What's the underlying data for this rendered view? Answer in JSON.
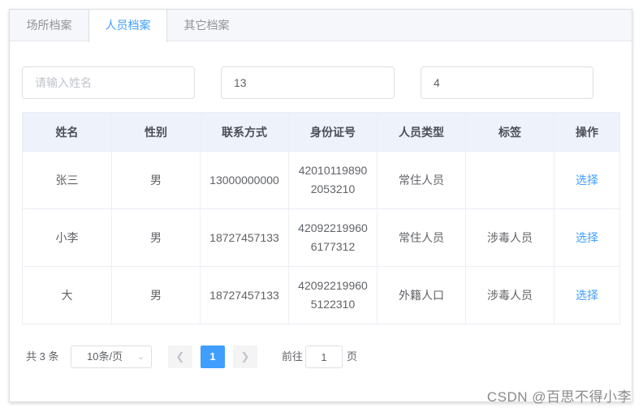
{
  "tabs": [
    {
      "label": "场所档案",
      "active": false
    },
    {
      "label": "人员档案",
      "active": true
    },
    {
      "label": "其它档案",
      "active": false
    }
  ],
  "filters": {
    "name_placeholder": "请输入姓名",
    "field2_value": "13",
    "field3_value": "4"
  },
  "table": {
    "columns": [
      "姓名",
      "性别",
      "联系方式",
      "身份证号",
      "人员类型",
      "标签",
      "操作"
    ],
    "rows": [
      {
        "name": "张三",
        "gender": "男",
        "phone": "13000000000",
        "id": "420101198902053210",
        "type": "常住人员",
        "tag": "",
        "action": "选择"
      },
      {
        "name": "小李",
        "gender": "男",
        "phone": "18727457133",
        "id": "420922199606177312",
        "type": "常住人员",
        "tag": "涉毒人员",
        "action": "选择"
      },
      {
        "name": "大",
        "gender": "男",
        "phone": "18727457133",
        "id": "420922199605122310",
        "type": "外籍人口",
        "tag": "涉毒人员",
        "action": "选择"
      }
    ]
  },
  "pagination": {
    "total_text": "共 3 条",
    "page_size": "10条/页",
    "current_page": "1",
    "goto_label": "前往",
    "goto_value": "1",
    "page_suffix": "页"
  },
  "watermark": "CSDN @百思不得小李"
}
